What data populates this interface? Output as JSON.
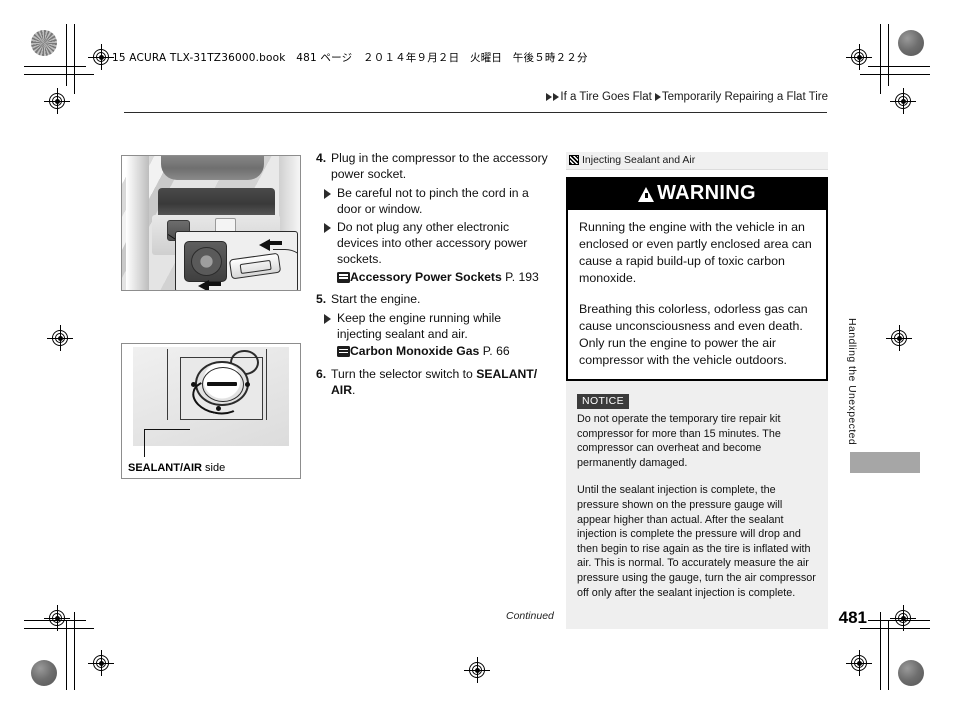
{
  "print_marks": {
    "book_line": "15 ACURA TLX-31TZ36000.book　481 ページ　２０１４年９月２日　火曜日　午後５時２２分"
  },
  "header": {
    "breadcrumb": [
      "If a Tire Goes Flat",
      "Temporarily Repairing a Flat Tire"
    ],
    "breadcrumb_text": "If a Tire Goes Flat Temporarily Repairing a Flat Tire"
  },
  "figures": {
    "figure1": {
      "name": "accessory-power-socket-photo",
      "caption": ""
    },
    "figure2": {
      "name": "selector-switch-diagram",
      "caption_bold": "SEALANT/AIR",
      "caption_rest": " side"
    }
  },
  "steps": [
    {
      "number": "4.",
      "text": "Plug in the compressor to the accessory power socket.",
      "bullets": [
        "Be careful not to pinch the cord in a door or window.",
        "Do not plug any other electronic devices into other accessory power sockets."
      ],
      "reference": {
        "title": "Accessory Power Sockets",
        "page": "P. 193"
      }
    },
    {
      "number": "5.",
      "text": "Start the engine.",
      "bullets": [
        "Keep the engine running while injecting sealant and air."
      ],
      "reference": {
        "title": "Carbon Monoxide Gas",
        "page": "P. 66"
      }
    },
    {
      "number": "6.",
      "text_before": "Turn the selector switch to ",
      "text_bold": "SEALANT/ AIR",
      "text_after": "."
    }
  ],
  "sidebar": {
    "section_label": "Injecting Sealant and Air",
    "warning": {
      "title": "WARNING",
      "paragraphs": [
        "Running the engine with the vehicle in an enclosed or even partly enclosed area can cause a rapid build-up of toxic carbon monoxide.",
        "Breathing this colorless, odorless gas can cause unconsciousness and even death. Only run the engine to power the air compressor with the vehicle outdoors."
      ]
    },
    "notice": {
      "tag": "NOTICE",
      "paragraphs": [
        "Do not operate the temporary tire repair kit compressor for more than 15 minutes. The compressor can overheat and become permanently damaged.",
        "Until the sealant injection is complete, the pressure shown on the pressure gauge will appear higher than actual. After the sealant injection is complete the pressure will drop and then begin to rise again as the tire is inflated with air. This is normal. To accurately measure the air pressure using the gauge, turn the air compressor off only after the sealant injection is complete."
      ]
    }
  },
  "side_tab": {
    "label": "Handling the Unexpected"
  },
  "footer": {
    "continued": "Continued",
    "page_number": "481"
  },
  "colors": {
    "warning_bar": "#000000",
    "notice_bg": "#efefef",
    "tab_block": "#a6a6a6"
  }
}
